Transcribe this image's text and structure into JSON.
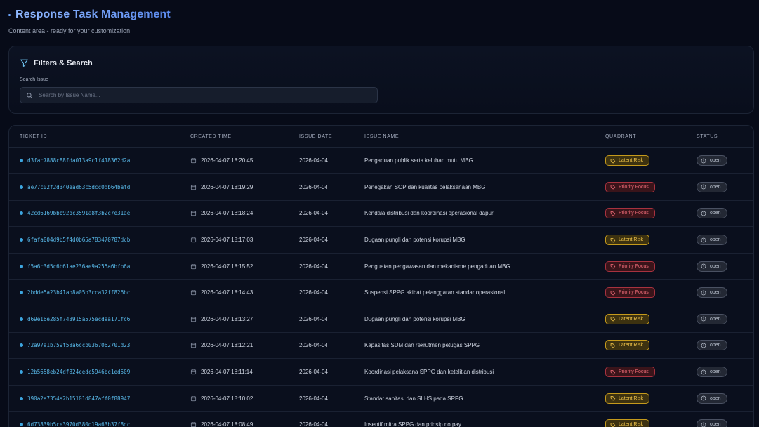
{
  "header": {
    "title": "Response Task Management",
    "subtitle": "Content area - ready for your customization"
  },
  "filters": {
    "title": "Filters & Search",
    "search_label": "Search Issue",
    "search_placeholder": "Search by Issue Name...",
    "search_value": ""
  },
  "table": {
    "columns": [
      "TICKET ID",
      "CREATED TIME",
      "ISSUE DATE",
      "ISSUE NAME",
      "QUADRANT",
      "STATUS"
    ],
    "rows": [
      {
        "ticket_id": "d3fac7888c88fda013a9c1f418362d2a",
        "created_time": "2026-04-07 18:20:45",
        "issue_date": "2026-04-04",
        "issue_name": "Pengaduan publik serta keluhan mutu MBG",
        "quadrant": "Latent Risk",
        "status": "open"
      },
      {
        "ticket_id": "ae77c02f2d340ead63c5dcc0db64bafd",
        "created_time": "2026-04-07 18:19:29",
        "issue_date": "2026-04-04",
        "issue_name": "Penegakan SOP dan kualitas pelaksanaan MBG",
        "quadrant": "Priority Focus",
        "status": "open"
      },
      {
        "ticket_id": "42cd6169bbb92bc3591a8f3b2c7e31ae",
        "created_time": "2026-04-07 18:18:24",
        "issue_date": "2026-04-04",
        "issue_name": "Kendala distribusi dan koordinasi operasional dapur",
        "quadrant": "Priority Focus",
        "status": "open"
      },
      {
        "ticket_id": "6fafa004d9b5f4d0b65a783470787dcb",
        "created_time": "2026-04-07 18:17:03",
        "issue_date": "2026-04-04",
        "issue_name": "Dugaan pungli dan potensi korupsi MBG",
        "quadrant": "Latent Risk",
        "status": "open"
      },
      {
        "ticket_id": "f5a6c3d5c6b61ae236ae9a255a6bfb6a",
        "created_time": "2026-04-07 18:15:52",
        "issue_date": "2026-04-04",
        "issue_name": "Penguatan pengawasan dan mekanisme pengaduan MBG",
        "quadrant": "Priority Focus",
        "status": "open"
      },
      {
        "ticket_id": "2bdde5a23b41ab8a05b3cca32ff826bc",
        "created_time": "2026-04-07 18:14:43",
        "issue_date": "2026-04-04",
        "issue_name": "Suspensi SPPG akibat pelanggaran standar operasional",
        "quadrant": "Priority Focus",
        "status": "open"
      },
      {
        "ticket_id": "d69e16e285f743915a575ecdaa171fc6",
        "created_time": "2026-04-07 18:13:27",
        "issue_date": "2026-04-04",
        "issue_name": "Dugaan pungli dan potensi korupsi MBG",
        "quadrant": "Latent Risk",
        "status": "open"
      },
      {
        "ticket_id": "72a97a1b759f58a6ccb0367062701d23",
        "created_time": "2026-04-07 18:12:21",
        "issue_date": "2026-04-04",
        "issue_name": "Kapasitas SDM dan rekrutmen petugas SPPG",
        "quadrant": "Latent Risk",
        "status": "open"
      },
      {
        "ticket_id": "12b5658eb24df824cedc5946bc1ed509",
        "created_time": "2026-04-07 18:11:14",
        "issue_date": "2026-04-04",
        "issue_name": "Koordinasi pelaksana SPPG dan ketelitian distribusi",
        "quadrant": "Priority Focus",
        "status": "open"
      },
      {
        "ticket_id": "390a2a7354a2b15101d847aff0f88947",
        "created_time": "2026-04-07 18:10:02",
        "issue_date": "2026-04-04",
        "issue_name": "Standar sanitasi dan SLHS pada SPPG",
        "quadrant": "Latent Risk",
        "status": "open"
      },
      {
        "ticket_id": "6d73839b5ce3970d380d19a63b37f8dc",
        "created_time": "2026-04-07 18:08:49",
        "issue_date": "2026-04-04",
        "issue_name": "Insentif mitra SPPG dan prinsip no pay",
        "quadrant": "Latent Risk",
        "status": "open"
      }
    ]
  },
  "colors": {
    "background": "#070b18",
    "accent": "#6ea8ff",
    "ticket_id": "#58b8e8",
    "latent_risk": "#f2c54a",
    "priority_focus": "#ef6b78"
  },
  "icons": {
    "filter": "filter-icon",
    "search": "search-icon",
    "calendar": "calendar-icon",
    "tag": "tag-icon",
    "status": "clock-icon"
  }
}
